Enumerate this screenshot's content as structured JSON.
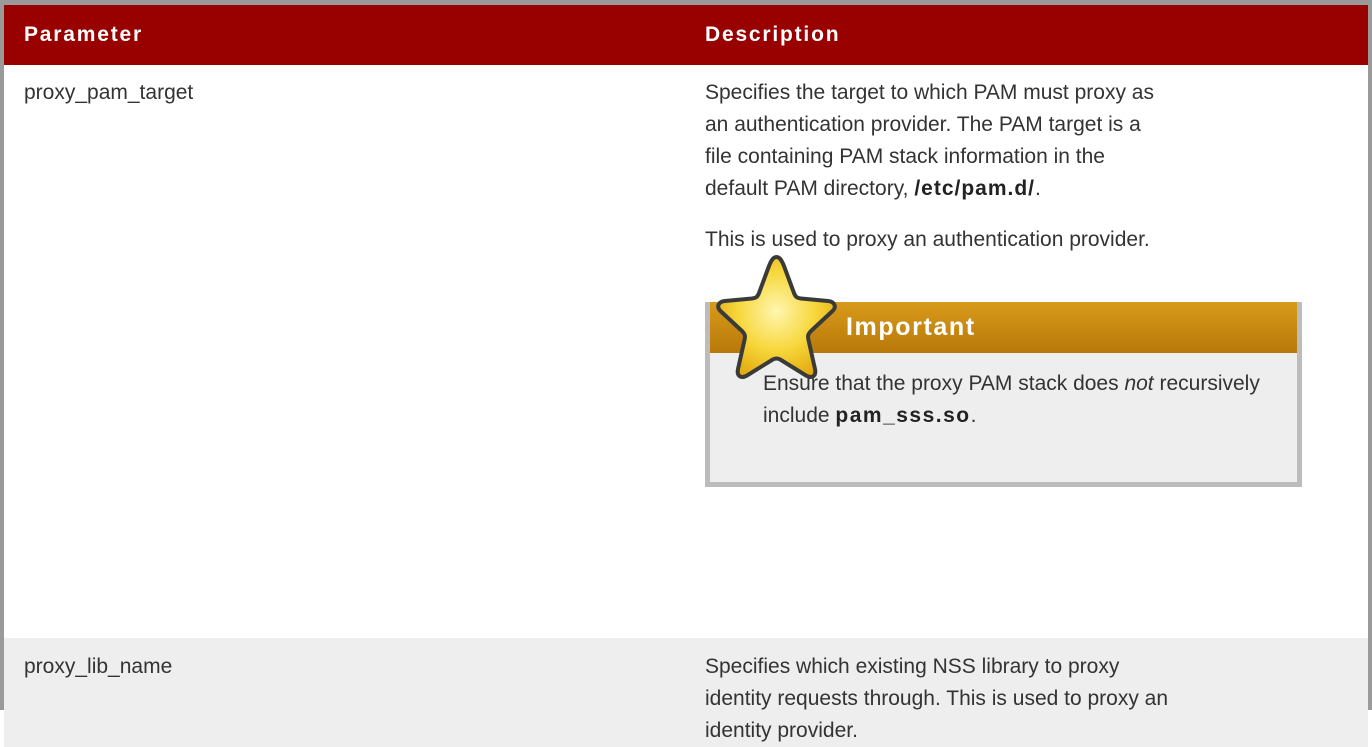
{
  "table": {
    "headers": {
      "parameter": "Parameter",
      "description": "Description"
    },
    "rows": [
      {
        "parameter": "proxy_pam_target",
        "description": {
          "para1_text": "Specifies the target to which PAM must proxy as an authentication provider. The PAM target is a file containing PAM stack information in the default PAM directory, ",
          "para1_path": "/etc/pam.d/",
          "para1_end": ".",
          "para2": "This is used to proxy an authentication provider.",
          "admonition": {
            "icon": "star-icon",
            "title": "Important",
            "text_before": "Ensure that the proxy PAM stack does ",
            "text_emphasis": "not",
            "text_middle": " recursively include ",
            "text_strong": "pam_sss.so",
            "text_end": "."
          }
        }
      },
      {
        "parameter": "proxy_lib_name",
        "description": {
          "text": "Specifies which existing NSS library to proxy identity requests through. This is used to proxy an identity provider."
        }
      }
    ]
  },
  "colors": {
    "header_bg": "#990000",
    "admonition_header": "#c88a12",
    "row_alt_bg": "#eeeeee",
    "border": "#9a9a9a"
  }
}
